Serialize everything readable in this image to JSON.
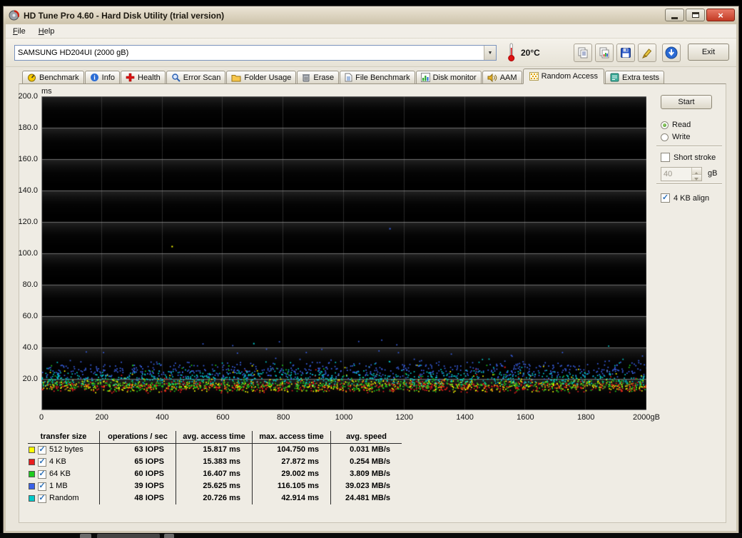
{
  "window": {
    "title": "HD Tune Pro 4.60 - Hard Disk Utility (trial version)"
  },
  "icons": {
    "close": "×",
    "dropdown_arrow": "▼",
    "check": "✓"
  },
  "menu": {
    "items": [
      {
        "label": "File"
      },
      {
        "label": "Help"
      }
    ]
  },
  "toolbar": {
    "drive_selector": {
      "value": "SAMSUNG HD204UI (2000 gB)"
    },
    "temperature": "20°C",
    "buttons": [
      {
        "icon": "copy-text-icon"
      },
      {
        "icon": "copy-image-icon"
      },
      {
        "icon": "save-icon"
      },
      {
        "icon": "capture-icon"
      },
      {
        "icon": "download-icon"
      }
    ],
    "exit_label": "Exit"
  },
  "tabs": [
    {
      "label": "Benchmark",
      "icon": "benchmark-icon",
      "active": false
    },
    {
      "label": "Info",
      "icon": "info-icon",
      "active": false
    },
    {
      "label": "Health",
      "icon": "health-icon",
      "active": false
    },
    {
      "label": "Error Scan",
      "icon": "error-scan-icon",
      "active": false
    },
    {
      "label": "Folder Usage",
      "icon": "folder-usage-icon",
      "active": false
    },
    {
      "label": "Erase",
      "icon": "erase-icon",
      "active": false
    },
    {
      "label": "File Benchmark",
      "icon": "file-benchmark-icon",
      "active": false
    },
    {
      "label": "Disk monitor",
      "icon": "disk-monitor-icon",
      "active": false
    },
    {
      "label": "AAM",
      "icon": "aam-icon",
      "active": false
    },
    {
      "label": "Random Access",
      "icon": "random-access-icon",
      "active": true
    },
    {
      "label": "Extra tests",
      "icon": "extra-tests-icon",
      "active": false
    }
  ],
  "side_panel": {
    "start_label": "Start",
    "mode": {
      "read_label": "Read",
      "write_label": "Write",
      "selected": "Read"
    },
    "short_stroke": {
      "label": "Short stroke",
      "checked": false,
      "value": "40",
      "unit": "gB",
      "enabled": false
    },
    "align": {
      "label": "4 KB align",
      "checked": true
    }
  },
  "chart_data": {
    "type": "scatter",
    "ylabel": "ms",
    "ylim": [
      0,
      200
    ],
    "xlim": [
      0,
      2000
    ],
    "grid": true,
    "yticks": [
      "200.0",
      "180.0",
      "160.0",
      "140.0",
      "120.0",
      "100.0",
      "80.0",
      "60.0",
      "40.0",
      "20.0"
    ],
    "xticks": [
      "0",
      "200",
      "400",
      "600",
      "800",
      "1000",
      "1200",
      "1400",
      "1600",
      "1800",
      "2000gB"
    ],
    "series": [
      {
        "name": "512 bytes",
        "color": "#ffff00",
        "iops": 63,
        "avg_ms": 15.817,
        "max_ms": 104.75,
        "avg_speed_mbs": 0.031,
        "min_ms": 8.5,
        "spread_ms": 4.5,
        "points": 640,
        "outlier_x": 430
      },
      {
        "name": "4 KB",
        "color": "#e81d1d",
        "iops": 65,
        "avg_ms": 15.383,
        "max_ms": 27.872,
        "avg_speed_mbs": 0.254,
        "min_ms": 8.5,
        "spread_ms": 4.2,
        "points": 640,
        "outlier_x": 1530
      },
      {
        "name": "64 KB",
        "color": "#1ecb1e",
        "iops": 60,
        "avg_ms": 16.407,
        "max_ms": 29.002,
        "avg_speed_mbs": 3.809,
        "min_ms": 9,
        "spread_ms": 4.6,
        "points": 640,
        "outlier_x": 300
      },
      {
        "name": "1 MB",
        "color": "#3a62e8",
        "iops": 39,
        "avg_ms": 25.625,
        "max_ms": 116.105,
        "avg_speed_mbs": 39.023,
        "min_ms": 13,
        "spread_ms": 6.5,
        "points": 640,
        "outlier_x": 1150
      },
      {
        "name": "Random",
        "color": "#00c9c9",
        "iops": 48,
        "avg_ms": 20.726,
        "max_ms": 42.914,
        "avg_speed_mbs": 24.481,
        "min_ms": 11,
        "spread_ms": 5.6,
        "points": 640,
        "outlier_x": 700
      }
    ]
  },
  "table": {
    "headers": [
      "transfer size",
      "operations / sec",
      "avg. access time",
      "max. access time",
      "avg. speed"
    ],
    "rows": [
      {
        "color": "#ffff00",
        "checked": true,
        "label": "512 bytes",
        "ops": "63 IOPS",
        "avg": "15.817 ms",
        "max": "104.750 ms",
        "speed": "0.031 MB/s"
      },
      {
        "color": "#e81d1d",
        "checked": true,
        "label": "4 KB",
        "ops": "65 IOPS",
        "avg": "15.383 ms",
        "max": "27.872 ms",
        "speed": "0.254 MB/s"
      },
      {
        "color": "#1ecb1e",
        "checked": true,
        "label": "64 KB",
        "ops": "60 IOPS",
        "avg": "16.407 ms",
        "max": "29.002 ms",
        "speed": "3.809 MB/s"
      },
      {
        "color": "#3a62e8",
        "checked": true,
        "label": "1 MB",
        "ops": "39 IOPS",
        "avg": "25.625 ms",
        "max": "116.105 ms",
        "speed": "39.023 MB/s"
      },
      {
        "color": "#00c9c9",
        "checked": true,
        "label": "Random",
        "ops": "48 IOPS",
        "avg": "20.726 ms",
        "max": "42.914 ms",
        "speed": "24.481 MB/s"
      }
    ]
  }
}
